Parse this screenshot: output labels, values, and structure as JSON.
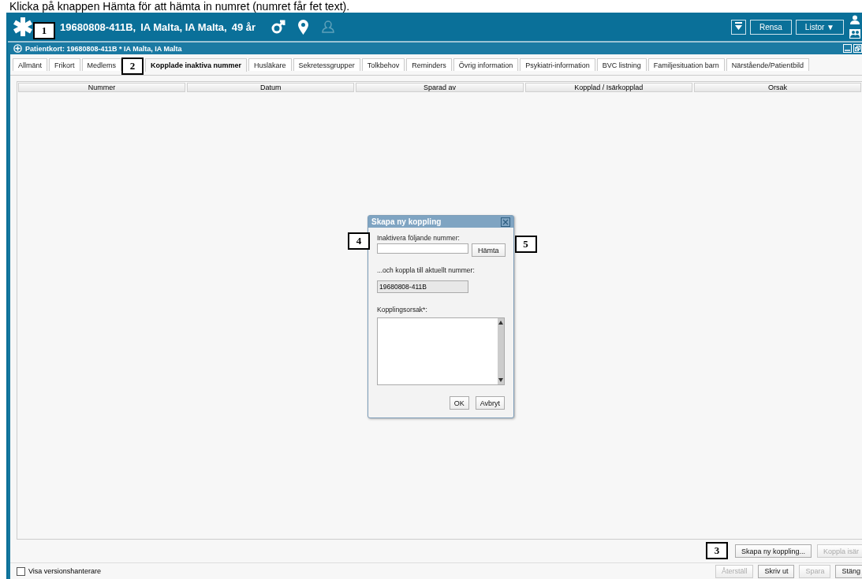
{
  "caption": "Klicka på knappen Hämta för att hämta in numret (numret får fet text).",
  "header": {
    "patient": "19680808-411B,",
    "name": "IA Malta, IA Malta,",
    "age": "49 år",
    "buttons": [
      {
        "label": "Rensa"
      },
      {
        "label": "Listor ▼"
      }
    ]
  },
  "window": {
    "title": "Patientkort: 19680808-411B * IA Malta, IA Malta"
  },
  "tabs": [
    {
      "label": "Allmänt",
      "selected": false
    },
    {
      "label": "Frikort",
      "selected": false
    },
    {
      "label": "Medlems",
      "selected": false
    },
    {
      "label": "Kopplade inaktiva nummer",
      "selected": true
    },
    {
      "label": "Husläkare",
      "selected": false
    },
    {
      "label": "Sekretessgrupper",
      "selected": false
    },
    {
      "label": "Tolkbehov",
      "selected": false
    },
    {
      "label": "Reminders",
      "selected": false
    },
    {
      "label": "Övrig information",
      "selected": false
    },
    {
      "label": "Psykiatri-information",
      "selected": false
    },
    {
      "label": "BVC listning",
      "selected": false
    },
    {
      "label": "Familjesituation barn",
      "selected": false
    },
    {
      "label": "Närstående/Patientbild",
      "selected": false
    }
  ],
  "table": {
    "columns": [
      "Nummer",
      "Datum",
      "Sparad av",
      "Kopplad / Isärkopplad",
      "Orsak"
    ]
  },
  "dialog": {
    "title": "Skapa ny koppling",
    "field_label": "Inaktivera följande nummer:",
    "fetch_button": "Hämta",
    "link_label": "...och koppla till aktuellt nummer:",
    "current_number": "19680808-411B",
    "reason_label": "Kopplingsorsak*:",
    "buttons": [
      "OK",
      "Avbryt"
    ]
  },
  "actions": [
    {
      "label": "Skapa ny koppling...",
      "disabled": false
    },
    {
      "label": "Koppla isär",
      "disabled": true
    }
  ],
  "footer": {
    "checkbox": {
      "label": "Visa versionshanterare",
      "checked": false
    },
    "buttons": [
      {
        "label": "Återställ",
        "disabled": true
      },
      {
        "label": "Skriv ut",
        "disabled": false
      },
      {
        "label": "Spara",
        "disabled": true
      },
      {
        "label": "Stäng",
        "disabled": false
      }
    ]
  },
  "callouts": [
    {
      "label": "1"
    },
    {
      "label": "2"
    },
    {
      "label": "3"
    },
    {
      "label": "4"
    },
    {
      "label": "5"
    }
  ]
}
